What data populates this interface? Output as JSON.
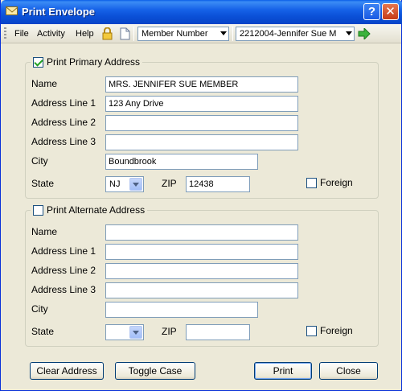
{
  "window": {
    "title": "Print Envelope"
  },
  "titlebar": {
    "help_glyph": "?",
    "close_glyph": "✕"
  },
  "menu": {
    "file": "File",
    "activity": "Activity",
    "help": "Help"
  },
  "toolbar": {
    "lookup_field": "Member Number",
    "member_value": "2212004-Jennifer Sue M",
    "icons": [
      "lock-icon",
      "document-icon",
      "go-arrow-icon"
    ]
  },
  "primary": {
    "legend": "Print Primary Address",
    "checked": true,
    "labels": {
      "name": "Name",
      "line1": "Address Line 1",
      "line2": "Address Line 2",
      "line3": "Address Line 3",
      "city": "City",
      "state": "State",
      "zip": "ZIP",
      "foreign": "Foreign"
    },
    "values": {
      "name": "MRS. JENNIFER SUE MEMBER",
      "line1": "123 Any Drive",
      "line2": "",
      "line3": "",
      "city": "Boundbrook",
      "state": "NJ",
      "zip": "12438"
    },
    "foreign_checked": false
  },
  "alternate": {
    "legend": "Print Alternate Address",
    "checked": false,
    "labels": {
      "name": "Name",
      "line1": "Address Line 1",
      "line2": "Address Line 2",
      "line3": "Address Line 3",
      "city": "City",
      "state": "State",
      "zip": "ZIP",
      "foreign": "Foreign"
    },
    "values": {
      "name": "",
      "line1": "",
      "line2": "",
      "line3": "",
      "city": "",
      "state": "",
      "zip": ""
    },
    "foreign_checked": false
  },
  "buttons": {
    "clear": "Clear Address",
    "toggle": "Toggle Case",
    "print": "Print",
    "close": "Close"
  }
}
